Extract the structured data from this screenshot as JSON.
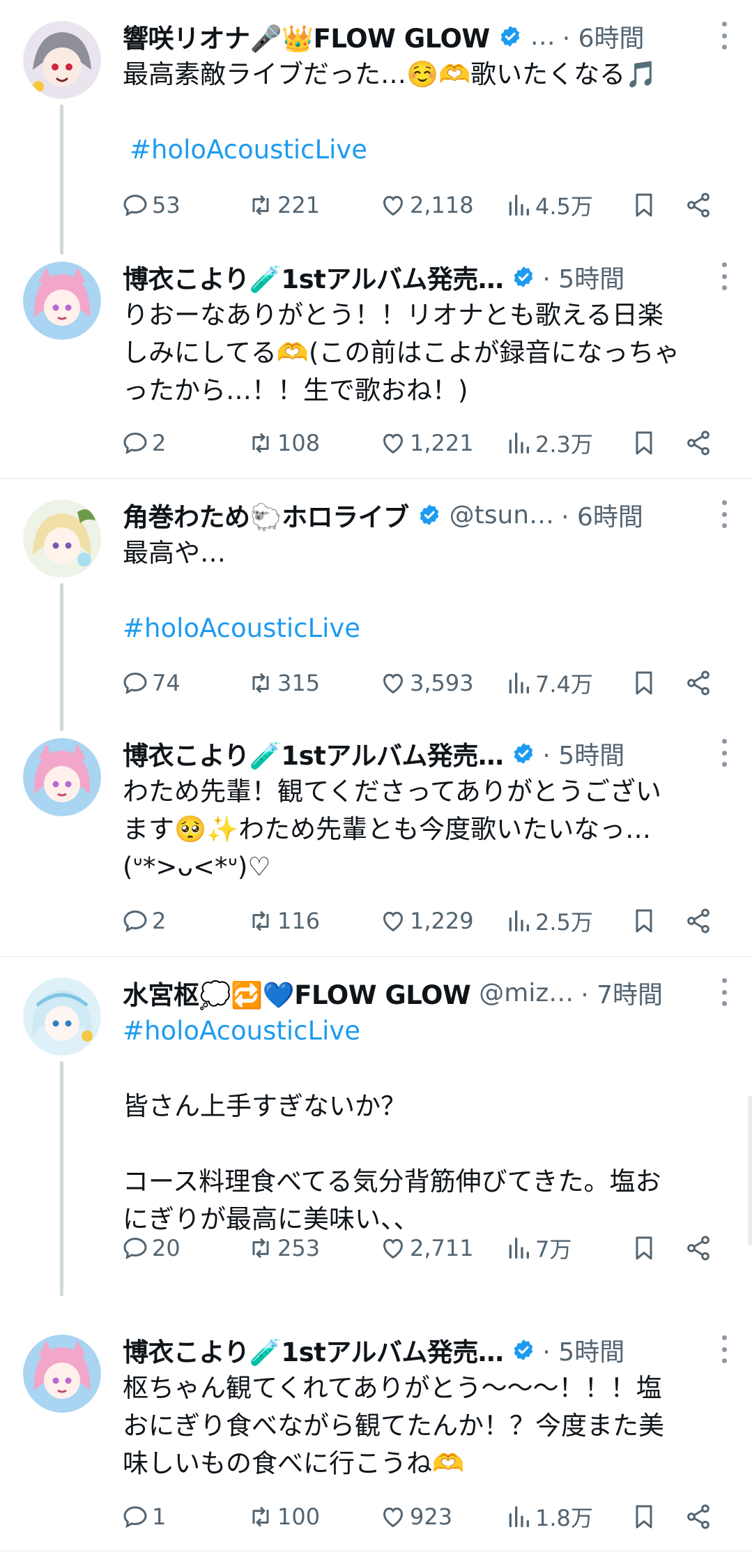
{
  "colors": {
    "accent": "#1d9bf0",
    "secondary_text": "#536471",
    "line": "#cfd9de"
  },
  "tweets": [
    {
      "name": "響咲リオナ🎤👑FLOW GLOW",
      "handle": "…",
      "time": "· 6時間",
      "lines": [
        "最高素敵ライブだった…☺️🫶歌いたくなる🎵",
        "",
        "#holoAcousticLive"
      ],
      "stats": {
        "replies": "53",
        "retweets": "221",
        "likes": "2,118",
        "views": "4.5万"
      }
    },
    {
      "name": "博衣こより🧪1stアルバム発売…",
      "handle": "",
      "time": "· 5時間",
      "lines": [
        "りおーなありがとう！！リオナとも歌える日楽",
        "しみにしてる🫶(この前はこよが録音になっちゃ",
        "ったから…！！生で歌おね！)"
      ],
      "stats": {
        "replies": "2",
        "retweets": "108",
        "likes": "1,221",
        "views": "2.3万"
      }
    },
    {
      "name": "角巻わため🐑ホロライブ",
      "handle": "@tsun…",
      "time": "· 6時間",
      "lines": [
        "最高や…",
        "",
        "#holoAcousticLive"
      ],
      "stats": {
        "replies": "74",
        "retweets": "315",
        "likes": "3,593",
        "views": "7.4万"
      }
    },
    {
      "name": "博衣こより🧪1stアルバム発売…",
      "handle": "",
      "time": "· 5時間",
      "lines": [
        "わため先輩！観てくださってありがとうござい",
        "ます🥺✨わため先輩とも今度歌いたいなっ…",
        "(ᐡ*>ᴗ<*ᐡ)♡"
      ],
      "stats": {
        "replies": "2",
        "retweets": "116",
        "likes": "1,229",
        "views": "2.5万"
      }
    },
    {
      "name": "水宮枢💭🔁💙FLOW GLOW",
      "handle": "@miz…",
      "time": "· 7時間",
      "lines": [
        "#holoAcousticLive",
        "",
        "皆さん上手すぎないか？",
        "",
        "コース料理食べてる気分背筋伸びてきた。塩お",
        "にぎりが最高に美味い、、"
      ],
      "stats": {
        "replies": "20",
        "retweets": "253",
        "likes": "2,711",
        "views": "7万"
      }
    },
    {
      "name": "博衣こより🧪1stアルバム発売…",
      "handle": "",
      "time": "· 5時間",
      "lines": [
        "枢ちゃん観てくれてありがとう〜〜〜！！！塩",
        "おにぎり食べながら観てたんか！？今度また美",
        "味しいもの食べに行こうね🫶"
      ],
      "stats": {
        "replies": "1",
        "retweets": "100",
        "likes": "923",
        "views": "1.8万"
      }
    }
  ]
}
